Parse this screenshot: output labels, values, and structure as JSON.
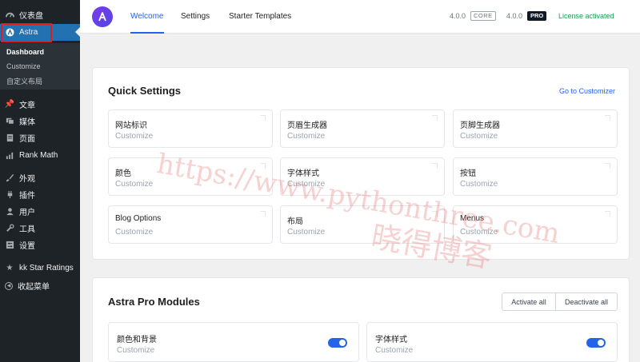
{
  "sidebar": {
    "items": [
      {
        "label": "仪表盘",
        "icon": "dashboard-icon"
      },
      {
        "label": "Astra",
        "icon": "astra-icon"
      },
      {
        "label": "文章",
        "icon": "pin-icon"
      },
      {
        "label": "媒体",
        "icon": "media-icon"
      },
      {
        "label": "页面",
        "icon": "page-icon"
      },
      {
        "label": "Rank Math",
        "icon": "rank-math-icon"
      },
      {
        "label": "外观",
        "icon": "brush-icon"
      },
      {
        "label": "插件",
        "icon": "plugin-icon"
      },
      {
        "label": "用户",
        "icon": "user-icon"
      },
      {
        "label": "工具",
        "icon": "wrench-icon"
      },
      {
        "label": "设置",
        "icon": "settings-icon"
      },
      {
        "label": "kk Star Ratings",
        "icon": "star-icon"
      },
      {
        "label": "收起菜单",
        "icon": "collapse-icon"
      }
    ],
    "submenu": [
      "Dashboard",
      "Customize",
      "自定义布局"
    ]
  },
  "header": {
    "tabs": [
      "Welcome",
      "Settings",
      "Starter Templates"
    ],
    "core_version": "4.0.0",
    "core_badge": "CORE",
    "pro_version": "4.0.0",
    "pro_badge": "PRO",
    "license": "License activated"
  },
  "quick_settings": {
    "title": "Quick Settings",
    "link": "Go to Customizer",
    "tiles": [
      {
        "title": "网站标识",
        "sub": "Customize"
      },
      {
        "title": "页眉生成器",
        "sub": "Customize"
      },
      {
        "title": "页脚生成器",
        "sub": "Customize"
      },
      {
        "title": "颜色",
        "sub": "Customize"
      },
      {
        "title": "字体样式",
        "sub": "Customize"
      },
      {
        "title": "按钮",
        "sub": "Customize"
      },
      {
        "title": "Blog Options",
        "sub": "Customize"
      },
      {
        "title": "布局",
        "sub": "Customize"
      },
      {
        "title": "Menus",
        "sub": "Customize"
      }
    ]
  },
  "pro_modules": {
    "title": "Astra Pro Modules",
    "activate_all": "Activate all",
    "deactivate_all": "Deactivate all",
    "modules": [
      {
        "title": "颜色和背景",
        "sub": "Customize",
        "enabled": true
      },
      {
        "title": "字体样式",
        "sub": "Customize",
        "enabled": true
      }
    ]
  },
  "watermark": {
    "url": "https://www.pythonthree.com",
    "text": "晓得博客"
  },
  "colors": {
    "accent": "#2563eb",
    "sidebar_bg": "#1d2327",
    "sidebar_active": "#2271b1",
    "license_green": "#16a34a"
  }
}
